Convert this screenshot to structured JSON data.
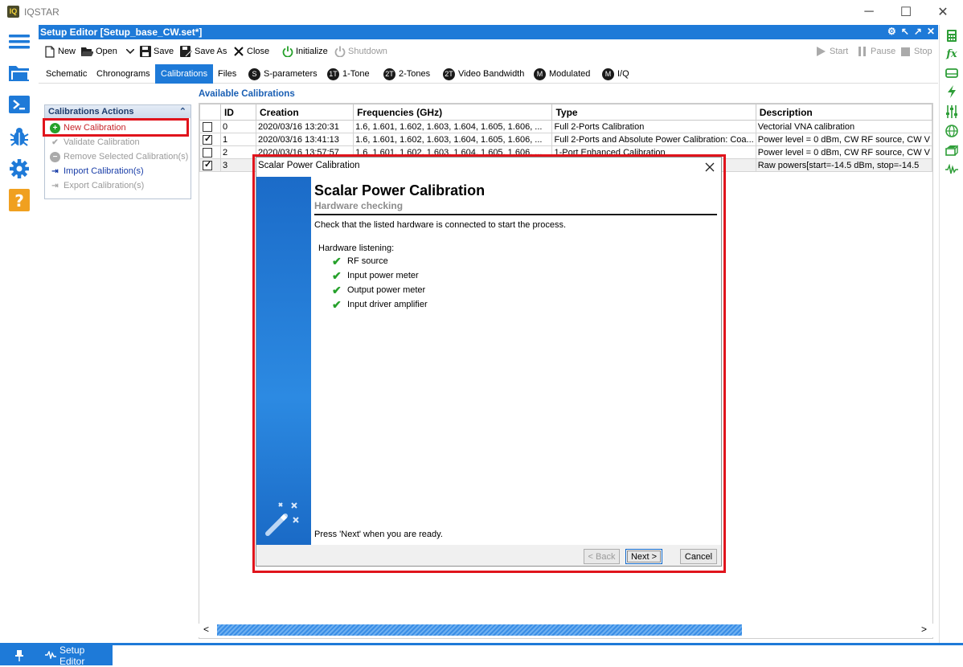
{
  "app": {
    "logo": "IQ",
    "title": "IQSTAR"
  },
  "window_controls": {
    "minimize": "─",
    "maximize": "☐",
    "close": "✕"
  },
  "left_dock": [
    "menu-icon",
    "folder-icon",
    "terminal-icon",
    "bug-icon",
    "gear-icon",
    "help-icon"
  ],
  "right_dock": [
    "calculator-icon",
    "function-icon",
    "drive-icon",
    "lightning-icon",
    "sliders-icon",
    "globe-icon",
    "hardware-icon",
    "waveform-icon"
  ],
  "editor": {
    "title": "Setup Editor [Setup_base_CW.set*]",
    "header_icons": [
      "⚙",
      "↖",
      "↗",
      "✕"
    ]
  },
  "toolbar": {
    "new": "New",
    "open": "Open",
    "save": "Save",
    "save_as": "Save As",
    "close": "Close",
    "initialize": "Initialize",
    "shutdown": "Shutdown",
    "start": "Start",
    "pause": "Pause",
    "stop": "Stop"
  },
  "tabs": [
    {
      "label": "Schematic"
    },
    {
      "label": "Chronograms"
    },
    {
      "label": "Calibrations",
      "active": true
    },
    {
      "label": "Files"
    },
    {
      "label": "S-parameters",
      "badge": "S"
    },
    {
      "label": "1-Tone",
      "badge": "1T"
    },
    {
      "label": "2-Tones",
      "badge": "2T"
    },
    {
      "label": "Video Bandwidth",
      "badge": "2T"
    },
    {
      "label": "Modulated",
      "badge": "M"
    },
    {
      "label": "I/Q",
      "badge": "M"
    }
  ],
  "actions": {
    "header": "Calibrations Actions",
    "items": [
      {
        "label": "New Calibration"
      },
      {
        "label": "Validate Calibration"
      },
      {
        "label": "Remove Selected Calibration(s)"
      },
      {
        "label": "Import Calibration(s)"
      },
      {
        "label": "Export Calibration(s)"
      }
    ]
  },
  "calibrations": {
    "title": "Available Calibrations",
    "columns": [
      "ID",
      "Creation",
      "Frequencies (GHz)",
      "Type",
      "Description"
    ],
    "rows": [
      {
        "checked": false,
        "id": "0",
        "creation": "2020/03/16 13:20:31",
        "freqs": "1.6, 1.601, 1.602, 1.603, 1.604, 1.605, 1.606, ...",
        "type": "Full 2-Ports Calibration",
        "desc": "Vectorial VNA calibration"
      },
      {
        "checked": true,
        "id": "1",
        "creation": "2020/03/16 13:41:13",
        "freqs": "1.6, 1.601, 1.602, 1.603, 1.604, 1.605, 1.606, ...",
        "type": "Full 2-Ports and Absolute Power Calibration: Coa...",
        "desc": "Power level = 0 dBm, CW RF source, CW V"
      },
      {
        "checked": false,
        "id": "2",
        "creation": "2020/03/16 13:57:57",
        "freqs": "1.6, 1.601, 1.602, 1.603, 1.604, 1.605, 1.606, ...",
        "type": "1-Port Enhanced Calibration",
        "desc": "Power level = 0 dBm, CW RF source, CW V"
      },
      {
        "checked": true,
        "id": "3",
        "creation": "",
        "freqs": "",
        "type": "",
        "desc": "Raw powers[start=-14.5 dBm, stop=-14.5"
      }
    ]
  },
  "scroll": {
    "left": "<",
    "right": ">"
  },
  "bottom": {
    "pin": "📌",
    "tab": "Setup Editor"
  },
  "modal": {
    "window_title": "Scalar Power Calibration",
    "heading": "Scalar Power Calibration",
    "subheading": "Hardware checking",
    "instruction": "Check that the listed hardware is connected to start the process.",
    "hw_label": "Hardware listening:",
    "hw_items": [
      "RF source",
      "Input power meter",
      "Output power meter",
      "Input driver amplifier"
    ],
    "ready": "Press 'Next' when you are ready.",
    "back": "< Back",
    "next": "Next >",
    "cancel": "Cancel"
  },
  "colors": {
    "accent": "#1e7ad8",
    "highlight_box": "#e0141c",
    "check": "#26a12b"
  }
}
